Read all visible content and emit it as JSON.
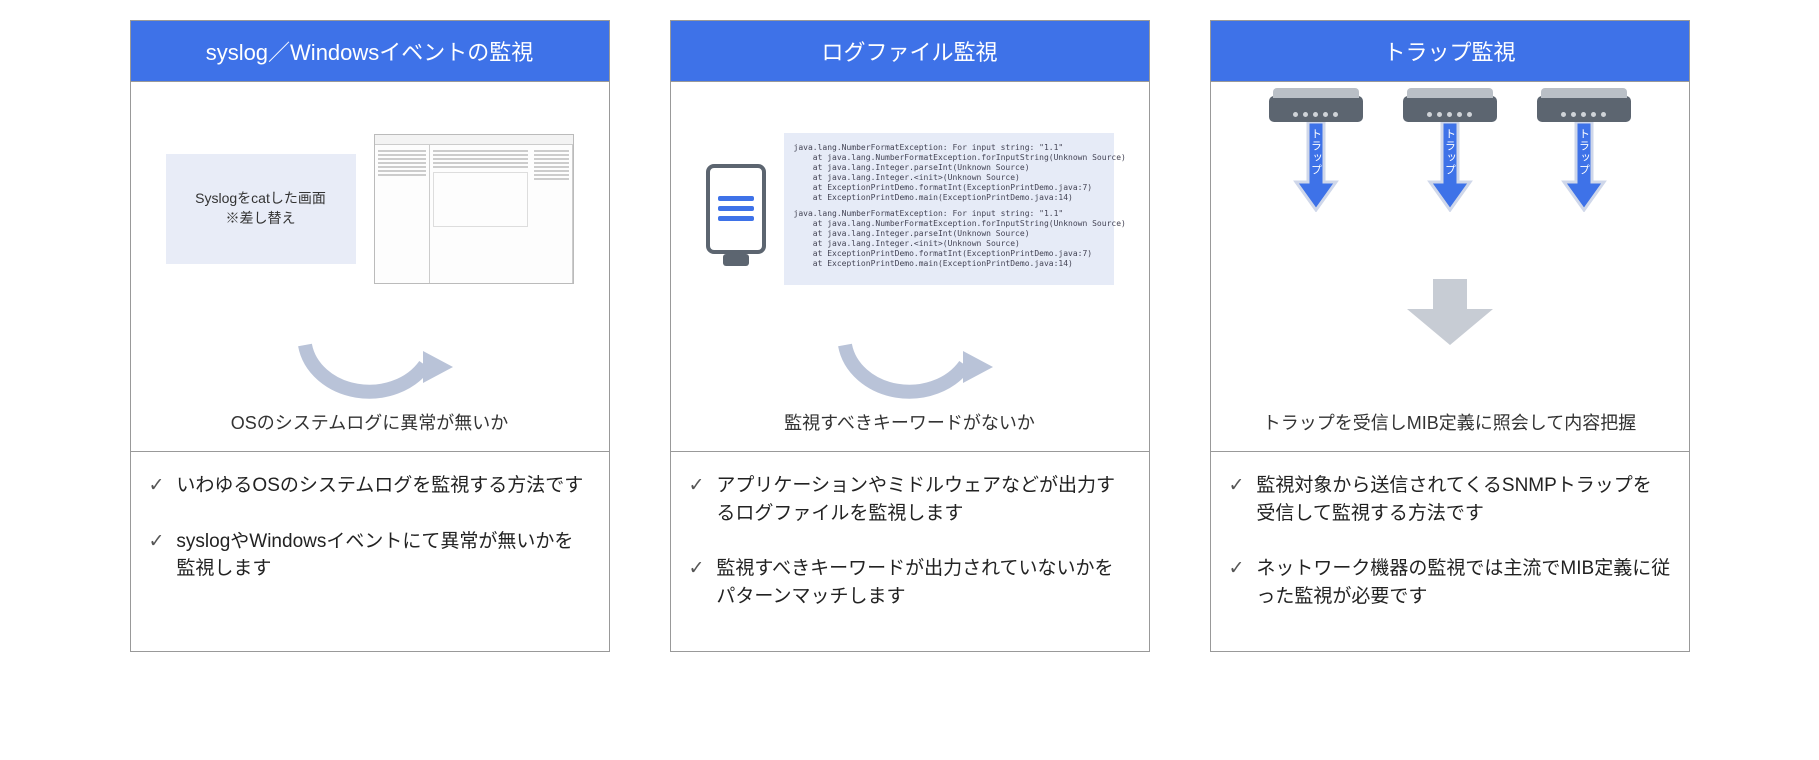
{
  "cards": [
    {
      "title": "syslog／Windowsイベントの監視",
      "placeholder_line1": "Syslogをcatした画面",
      "placeholder_line2": "※差し替え",
      "summary": "OSのシステムログに異常が無いか",
      "bullets": [
        "いわゆるOSのシステムログを監視する方法です",
        "syslogやWindowsイベントにて異常が無いかを監視します"
      ]
    },
    {
      "title": "ログファイル監視",
      "log_block1": "java.lang.NumberFormatException: For input string: \"1.1\"\n    at java.lang.NumberFormatException.forInputString(Unknown Source)\n    at java.lang.Integer.parseInt(Unknown Source)\n    at java.lang.Integer.<init>(Unknown Source)\n    at ExceptionPrintDemo.formatInt(ExceptionPrintDemo.java:7)\n    at ExceptionPrintDemo.main(ExceptionPrintDemo.java:14)",
      "log_block2": "java.lang.NumberFormatException: For input string: \"1.1\"\n    at java.lang.NumberFormatException.forInputString(Unknown Source)\n    at java.lang.Integer.parseInt(Unknown Source)\n    at java.lang.Integer.<init>(Unknown Source)\n    at ExceptionPrintDemo.formatInt(ExceptionPrintDemo.java:7)\n    at ExceptionPrintDemo.main(ExceptionPrintDemo.java:14)",
      "summary": "監視すべきキーワードがないか",
      "bullets": [
        "アプリケーションやミドルウェアなどが出力するログファイルを監視します",
        "監視すべきキーワードが出力されていないかをパターンマッチします"
      ]
    },
    {
      "title": "トラップ監視",
      "trap_label": "トラップ",
      "summary": "トラップを受信しMIB定義に照会して内容把握",
      "bullets": [
        "監視対象から送信されてくるSNMPトラップを受信して監視する方法です",
        "ネットワーク機器の監視では主流でMIB定義に従った監視が必要です"
      ]
    }
  ]
}
